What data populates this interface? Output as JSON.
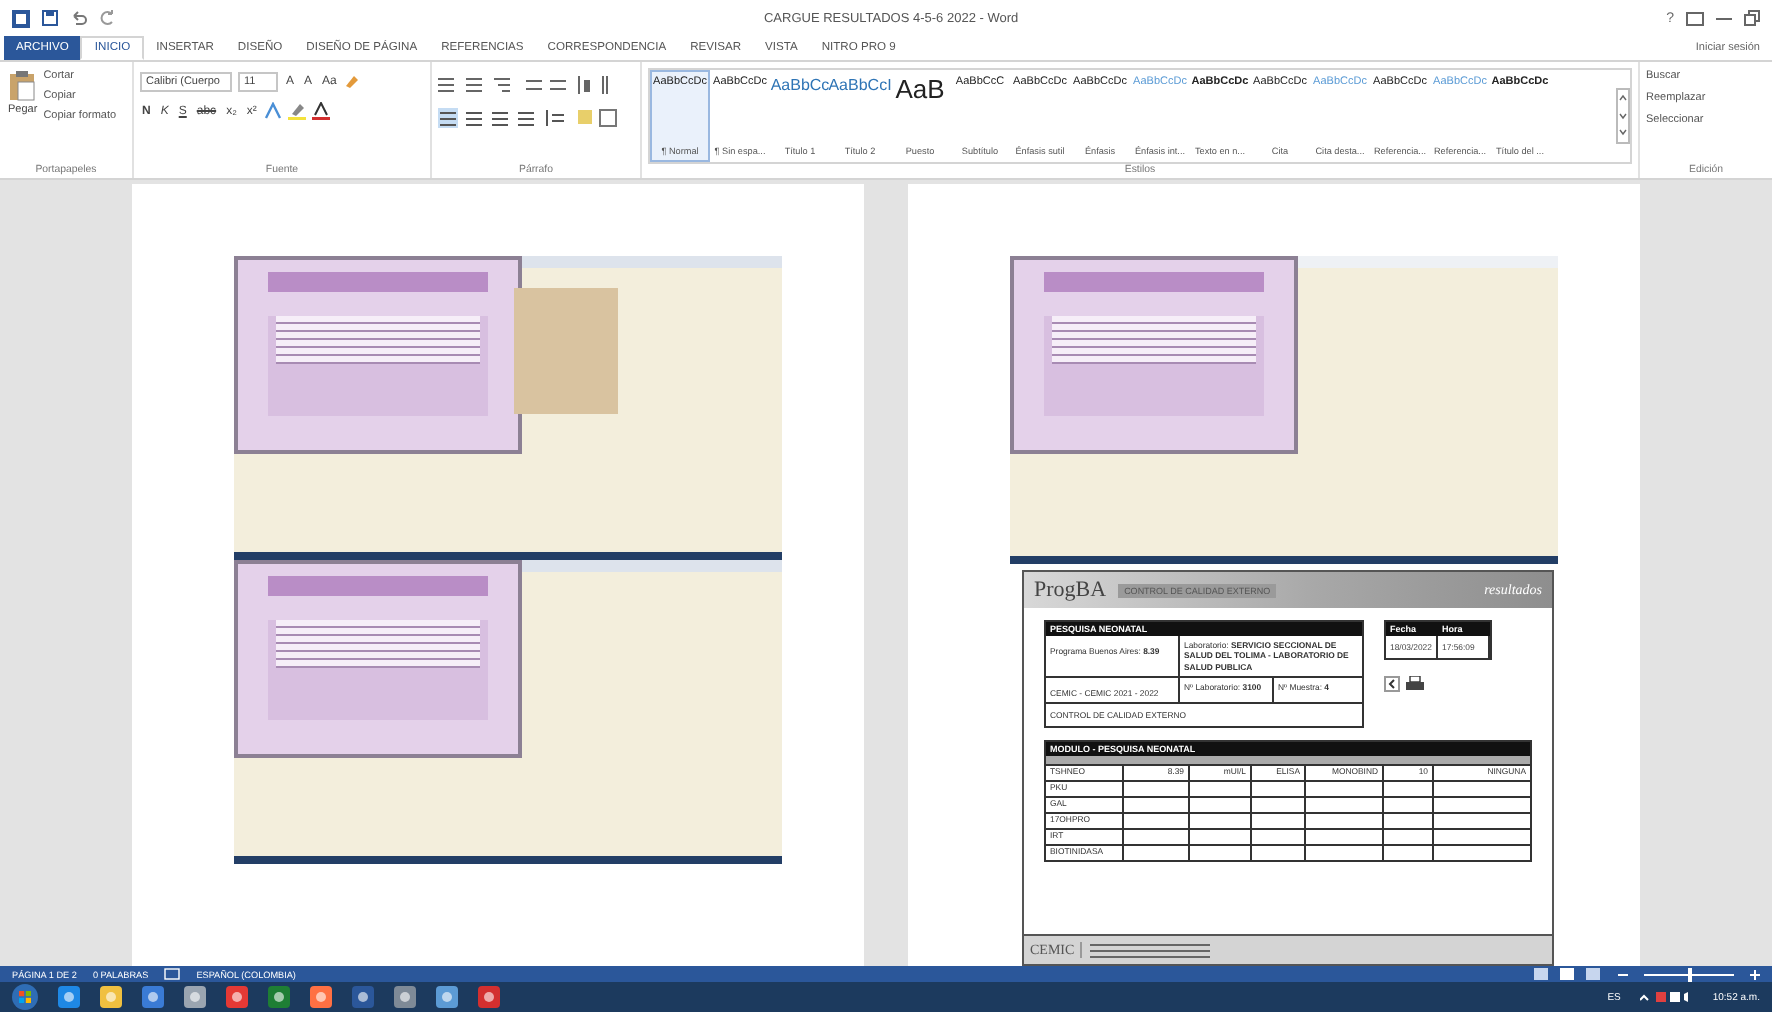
{
  "window": {
    "title": "CARGUE RESULTADOS 4-5-6 2022 - Word",
    "help": "?",
    "sign_in": "Iniciar sesión"
  },
  "ribbon_tabs": [
    {
      "label": "ARCHIVO",
      "kind": "file",
      "selected": false
    },
    {
      "label": "INICIO",
      "kind": "tab",
      "selected": true
    },
    {
      "label": "INSERTAR",
      "kind": "tab",
      "selected": false
    },
    {
      "label": "DISEÑO",
      "kind": "tab",
      "selected": false
    },
    {
      "label": "DISEÑO DE PÁGINA",
      "kind": "tab",
      "selected": false
    },
    {
      "label": "REFERENCIAS",
      "kind": "tab",
      "selected": false
    },
    {
      "label": "CORRESPONDENCIA",
      "kind": "tab",
      "selected": false
    },
    {
      "label": "REVISAR",
      "kind": "tab",
      "selected": false
    },
    {
      "label": "VISTA",
      "kind": "tab",
      "selected": false
    },
    {
      "label": "NITRO PRO 9",
      "kind": "tab",
      "selected": false
    }
  ],
  "clipboard": {
    "group": "Portapapeles",
    "paste": "Pegar",
    "items": [
      "Cortar",
      "Copiar",
      "Copiar formato"
    ]
  },
  "font": {
    "group": "Fuente",
    "name": "Calibri (Cuerpo",
    "size": "11",
    "size_buttons": [
      "A",
      "A",
      "Aa"
    ],
    "format_buttons": [
      "N",
      "K",
      "S",
      "abc",
      "x₂",
      "x²"
    ]
  },
  "paragraph": {
    "group": "Párrafo"
  },
  "styles": {
    "group": "Estilos",
    "items": [
      {
        "preview": "AaBbCcDc",
        "name": "¶ Normal",
        "kind": "plain",
        "selected": true
      },
      {
        "preview": "AaBbCcDc",
        "name": "¶ Sin espa...",
        "kind": "plain",
        "selected": false
      },
      {
        "preview": "AaBbCc",
        "name": "Título 1",
        "kind": "heading",
        "selected": false
      },
      {
        "preview": "AaBbCcI",
        "name": "Título 2",
        "kind": "heading",
        "selected": false
      },
      {
        "preview": "AaB",
        "name": "Puesto",
        "kind": "title",
        "selected": false
      },
      {
        "preview": "AaBbCcC",
        "name": "Subtítulo",
        "kind": "plain",
        "selected": false
      },
      {
        "preview": "AaBbCcDc",
        "name": "Énfasis sutil",
        "kind": "plain",
        "selected": false
      },
      {
        "preview": "AaBbCcDc",
        "name": "Énfasis",
        "kind": "plain",
        "selected": false
      },
      {
        "preview": "AaBbCcDc",
        "name": "Énfasis int...",
        "kind": "accent",
        "selected": false
      },
      {
        "preview": "AaBbCcDc",
        "name": "Texto en n...",
        "kind": "bold",
        "selected": false
      },
      {
        "preview": "AaBbCcDc",
        "name": "Cita",
        "kind": "plain",
        "selected": false
      },
      {
        "preview": "AaBbCcDc",
        "name": "Cita desta...",
        "kind": "accent",
        "selected": false
      },
      {
        "preview": "AaBbCcDc",
        "name": "Referencia...",
        "kind": "plain",
        "selected": false
      },
      {
        "preview": "AaBbCcDc",
        "name": "Referencia...",
        "kind": "accent",
        "selected": false
      },
      {
        "preview": "AaBbCcDc",
        "name": "Título del ...",
        "kind": "bold",
        "selected": false
      }
    ]
  },
  "editing": {
    "group": "Edición",
    "items": [
      "Buscar",
      "Reemplazar",
      "Seleccionar"
    ]
  },
  "report": {
    "logo": "ProgBA",
    "banner": "CONTROL DE CALIDAD EXTERNO",
    "tagline": "resultados",
    "panel_title": "PESQUISA NEONATAL",
    "program": "Programa Buenos Aires: **8.39**",
    "laboratory": "Laboratorio: **SERVICIO SECCIONAL DE SALUD DEL TOLIMA - LABORATORIO DE SALUD PUBLICA**",
    "cycle": "CEMIC - CEMIC 2021 - 2022",
    "lab_number": "Nº Laboratorio: **3100**",
    "sample": "Nº Muestra: **4**",
    "control": "CONTROL DE CALIDAD EXTERNO",
    "date_header": "Fecha",
    "time_header": "Hora",
    "date": "18/03/2022",
    "time": "17:56:09",
    "module_title": "MODULO - PESQUISA NEONATAL",
    "rows": [
      [
        "TSHNEO",
        "8.39",
        "mUI/L",
        "ELISA",
        "MONOBIND",
        "10",
        "NINGUNA"
      ],
      [
        "PKU",
        "",
        "",
        "",
        "",
        "",
        ""
      ],
      [
        "GAL",
        "",
        "",
        "",
        "",
        "",
        ""
      ],
      [
        "17OHPRO",
        "",
        "",
        "",
        "",
        "",
        ""
      ],
      [
        "IRT",
        "",
        "",
        "",
        "",
        "",
        ""
      ],
      [
        "BIOTINIDASA",
        "",
        "",
        "",
        "",
        "",
        ""
      ]
    ],
    "footer_logo": "CEMIC"
  },
  "status_bar": {
    "page": "PÁGINA 1 DE 2",
    "words": "0 PALABRAS",
    "language": "ESPAÑOL (COLOMBIA)",
    "zoom": {
      "level": 0.5
    }
  },
  "taskbar": {
    "language": "ES",
    "time": "10:52 a.m."
  }
}
